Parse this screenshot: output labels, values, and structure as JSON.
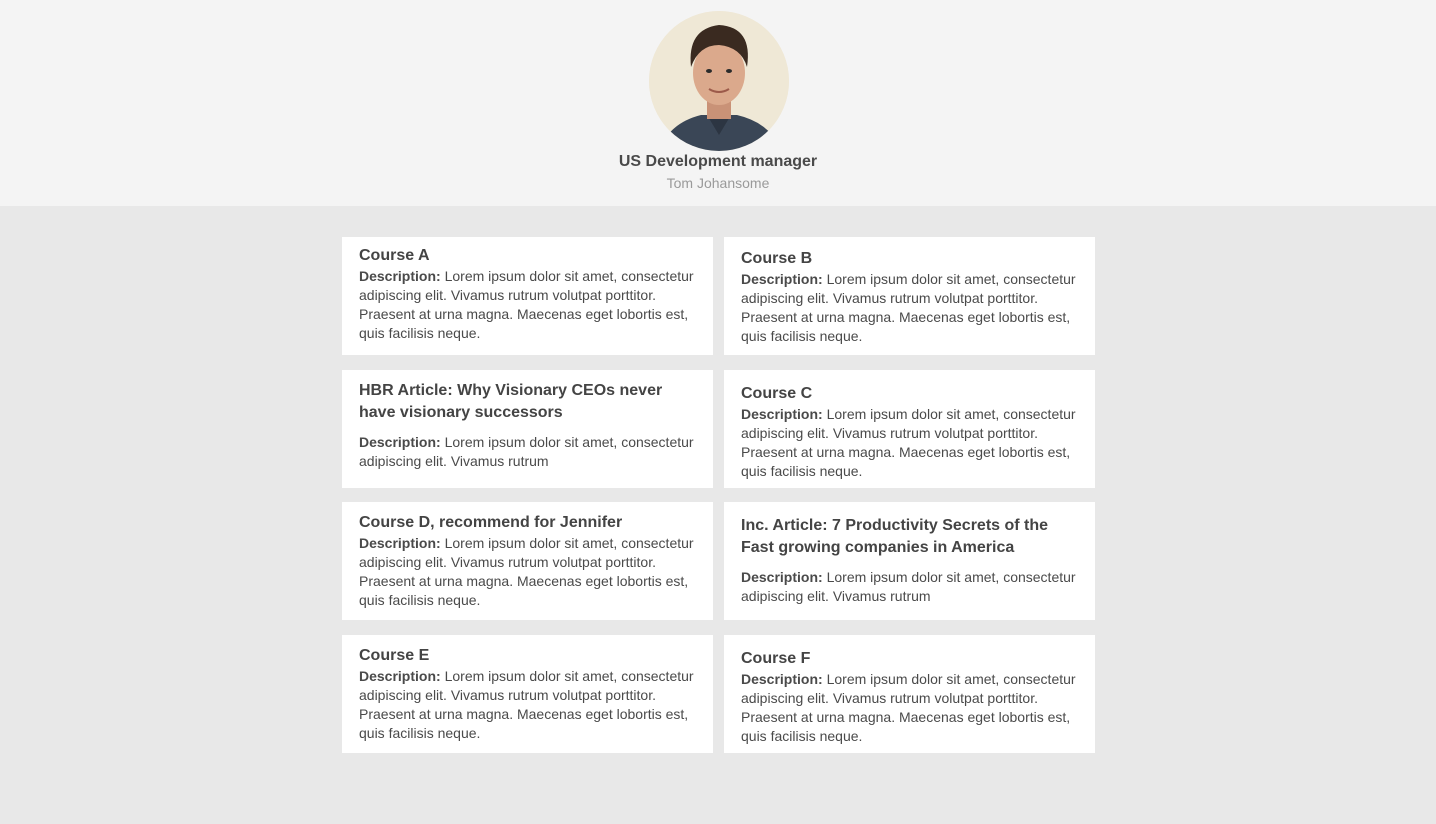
{
  "profile": {
    "role": "US Development manager",
    "name": "Tom Johansome"
  },
  "description_label": "Description:",
  "cards": [
    {
      "title": "Course A",
      "description": "Lorem ipsum dolor sit amet, consectetur adipiscing elit. Vivamus rutrum volutpat porttitor. Praesent at urna magna. Maecenas eget lobortis est, quis facilisis neque."
    },
    {
      "title": "Course B",
      "description": "Lorem ipsum dolor sit amet, consectetur adipiscing elit. Vivamus rutrum volutpat porttitor. Praesent at urna magna. Maecenas eget lobortis est, quis facilisis neque."
    },
    {
      "title": "HBR Article: Why Visionary CEOs never have visionary successors",
      "description": "Lorem ipsum dolor sit amet, consectetur adipiscing elit. Vivamus rutrum"
    },
    {
      "title": "Course C",
      "description": "Lorem ipsum dolor sit amet, consectetur adipiscing elit. Vivamus rutrum volutpat porttitor. Praesent at urna magna. Maecenas eget lobortis est, quis facilisis neque."
    },
    {
      "title": "Course D, recommend for Jennifer",
      "description": "Lorem ipsum dolor sit amet, consectetur adipiscing elit. Vivamus rutrum volutpat porttitor. Praesent at urna magna. Maecenas eget lobortis est, quis facilisis neque."
    },
    {
      "title": "Inc. Article: 7 Productivity Secrets of the Fast growing companies in America",
      "description": "Lorem ipsum dolor sit amet, consectetur adipiscing elit. Vivamus rutrum"
    },
    {
      "title": "Course E",
      "description": "Lorem ipsum dolor sit amet, consectetur adipiscing elit. Vivamus rutrum volutpat porttitor. Praesent at urna magna. Maecenas eget lobortis est, quis facilisis neque."
    },
    {
      "title": "Course F",
      "description": "Lorem ipsum dolor sit amet, consectetur adipiscing elit. Vivamus rutrum volutpat porttitor. Praesent at urna magna. Maecenas eget lobortis est, quis facilisis neque."
    }
  ]
}
